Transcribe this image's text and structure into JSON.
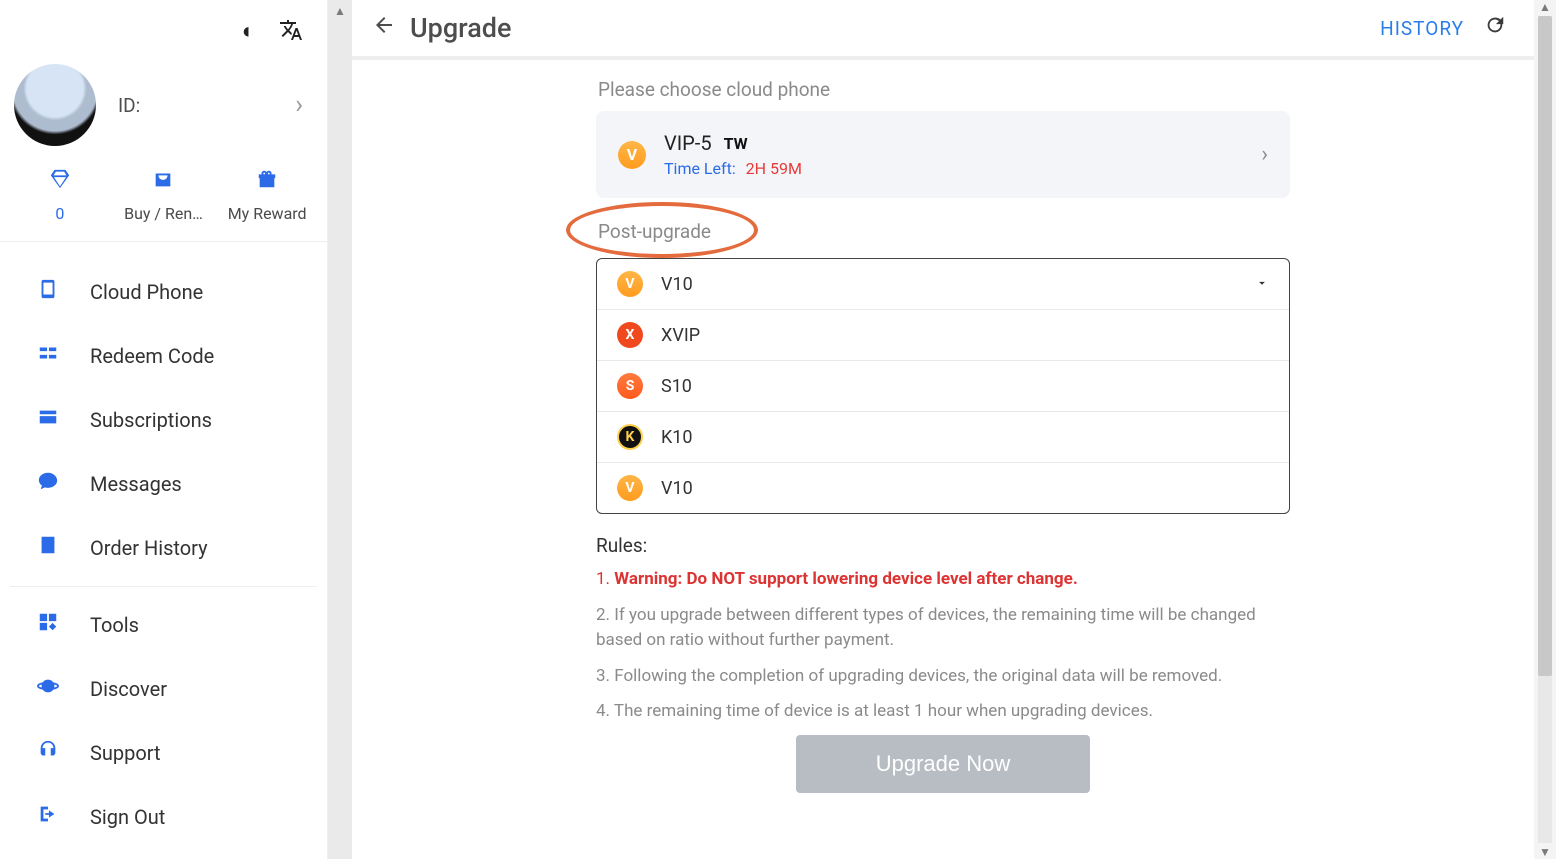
{
  "sidebar": {
    "id_label": "ID:",
    "quick": {
      "diamonds": {
        "value": "0"
      },
      "buy": {
        "label": "Buy / Ren…"
      },
      "reward": {
        "label": "My Reward"
      }
    },
    "items": [
      {
        "label": "Cloud Phone"
      },
      {
        "label": "Redeem Code"
      },
      {
        "label": "Subscriptions"
      },
      {
        "label": "Messages"
      },
      {
        "label": "Order History"
      },
      {
        "label": "Tools"
      },
      {
        "label": "Discover"
      },
      {
        "label": "Support"
      },
      {
        "label": "Sign Out"
      }
    ]
  },
  "header": {
    "title": "Upgrade",
    "history": "HISTORY"
  },
  "choose_label": "Please choose cloud phone",
  "phone": {
    "badge": "V",
    "name": "VIP-5",
    "tag": "TW",
    "time_left_label": "Time Left:",
    "time_left_value": "2H  59M"
  },
  "post_upgrade_label": "Post-upgrade",
  "options": [
    {
      "badge": "V",
      "badgeClass": "badge-vv",
      "label": "V10",
      "has_chevron": true
    },
    {
      "badge": "X",
      "badgeClass": "badge-x",
      "label": "XVIP"
    },
    {
      "badge": "S",
      "badgeClass": "badge-s",
      "label": "S10"
    },
    {
      "badge": "K",
      "badgeClass": "badge-k",
      "label": "K10"
    },
    {
      "badge": "V",
      "badgeClass": "badge-vv",
      "label": "V10"
    }
  ],
  "rules": {
    "title": "Rules:",
    "r1num": "1. ",
    "r1warn": "Warning: Do NOT support lowering device level after change.",
    "r2": "2. If you upgrade between different types of devices, the remaining time will be changed based on ratio without further payment.",
    "r3": "3. Following the completion of upgrading devices, the original data will be removed.",
    "r4": "4. The remaining time of device is at least 1 hour when upgrading devices."
  },
  "upgrade_button": "Upgrade Now"
}
